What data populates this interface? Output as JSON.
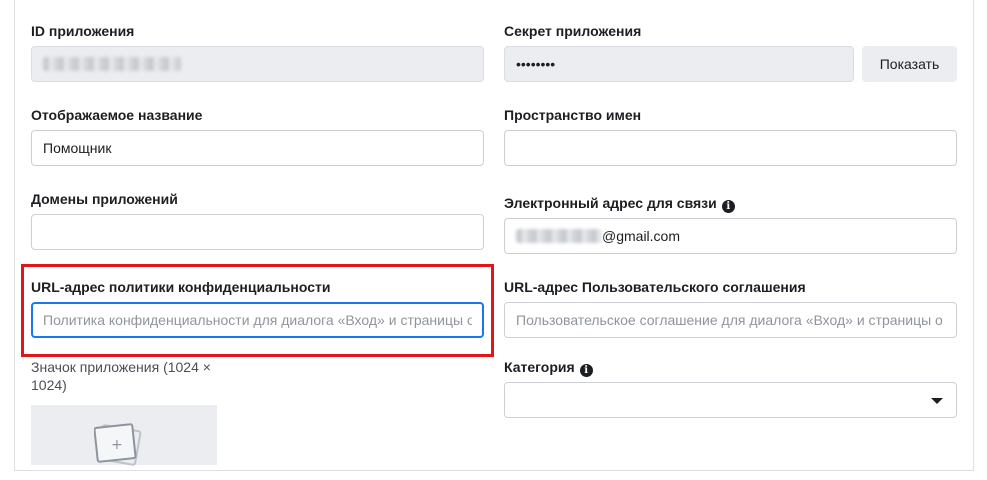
{
  "left": {
    "app_id_label": "ID приложения",
    "display_name_label": "Отображаемое название",
    "display_name_value": "Помощник",
    "app_domains_label": "Домены приложений",
    "privacy_url_label": "URL-адрес политики конфиденциальности",
    "privacy_url_placeholder": "Политика конфиденциальности для диалога «Вход» и страницы о",
    "app_icon_label_line1": "Значок приложения (1024 ×",
    "app_icon_label_line2": "1024)"
  },
  "right": {
    "app_secret_label": "Секрет приложения",
    "app_secret_value": "••••••••",
    "show_button_label": "Показать",
    "namespace_label": "Пространство имен",
    "contact_email_label": "Электронный адрес для связи",
    "contact_email_suffix": "@gmail.com",
    "tos_url_label": "URL-адрес Пользовательского соглашения",
    "tos_url_placeholder": "Пользовательское соглашение для диалога «Вход» и страницы о",
    "category_label": "Категория"
  },
  "icons": {
    "info": "info-icon",
    "dropdown": "chevron-down-icon",
    "image_placeholder": "image-add-icon"
  },
  "colors": {
    "highlight": "#e0161a",
    "focus": "#1877f2"
  }
}
